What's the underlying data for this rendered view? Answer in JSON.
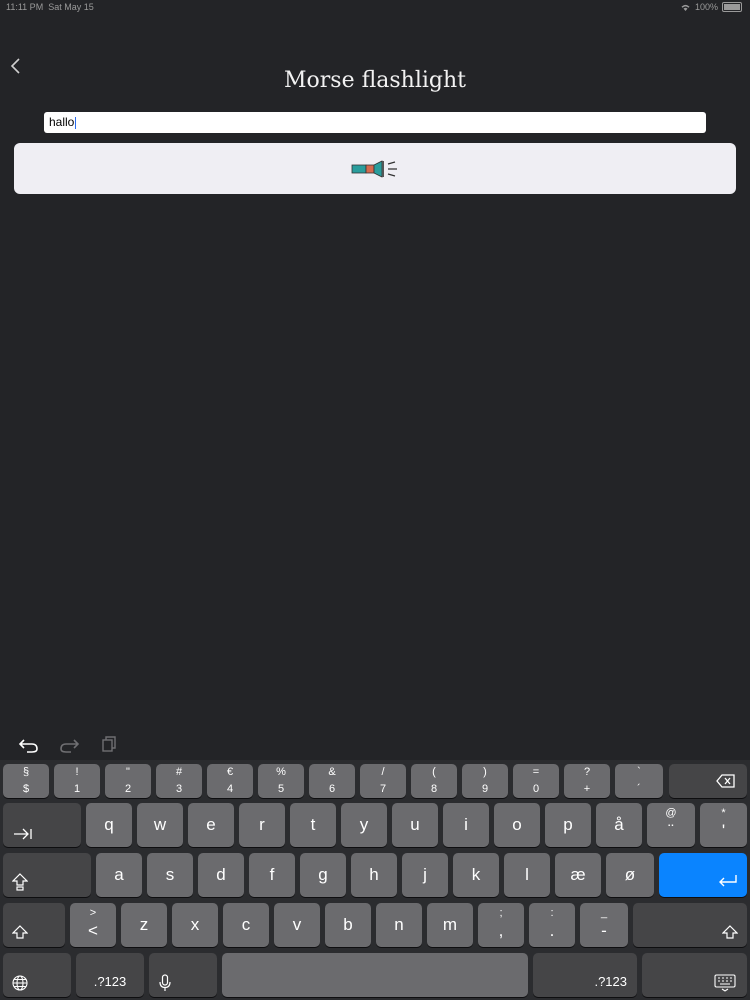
{
  "status_bar": {
    "time": "11:11 PM",
    "date": "Sat May 15",
    "battery": "100%"
  },
  "header": {
    "title": "Morse flashlight"
  },
  "input": {
    "value": "hallo"
  },
  "flash_button": {
    "icon": "flashlight-icon"
  },
  "keyboard": {
    "toolbar_icons": [
      "undo-icon",
      "redo-icon",
      "clipboard-icon"
    ],
    "number_row": [
      {
        "top": "§",
        "bottom": "$"
      },
      {
        "top": "!",
        "bottom": "1"
      },
      {
        "top": "\"",
        "bottom": "2"
      },
      {
        "top": "#",
        "bottom": "3"
      },
      {
        "top": "€",
        "bottom": "4"
      },
      {
        "top": "%",
        "bottom": "5"
      },
      {
        "top": "&",
        "bottom": "6"
      },
      {
        "top": "/",
        "bottom": "7"
      },
      {
        "top": "(",
        "bottom": "8"
      },
      {
        "top": ")",
        "bottom": "9"
      },
      {
        "top": "=",
        "bottom": "0"
      },
      {
        "top": "?",
        "bottom": "+"
      },
      {
        "top": "`",
        "bottom": "´"
      }
    ],
    "row_q": [
      "q",
      "w",
      "e",
      "r",
      "t",
      "y",
      "u",
      "i",
      "o",
      "p",
      "å"
    ],
    "row_q_extra": [
      {
        "top": "@",
        "bottom": "¨"
      },
      {
        "top": "*",
        "bottom": "'"
      }
    ],
    "row_a": [
      "a",
      "s",
      "d",
      "f",
      "g",
      "h",
      "j",
      "k",
      "l",
      "æ",
      "ø"
    ],
    "row_z_extra_left": {
      "top": ">",
      "bottom": "<"
    },
    "row_z": [
      "z",
      "x",
      "c",
      "v",
      "b",
      "n",
      "m"
    ],
    "row_z_extra_right": [
      {
        "top": ";",
        "bottom": ","
      },
      {
        "top": ":",
        "bottom": "."
      },
      {
        "top": "_",
        "bottom": "-"
      }
    ],
    "numbers_label": ".?123"
  }
}
